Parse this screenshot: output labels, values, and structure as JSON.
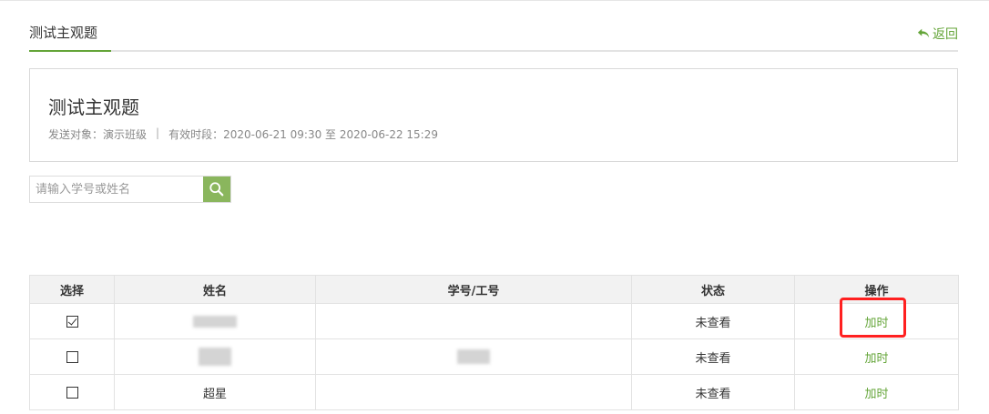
{
  "tabs": [
    {
      "label": "测试主观题",
      "active": true
    }
  ],
  "back_label": "返回",
  "info": {
    "title": "测试主观题",
    "target_label": "发送对象：",
    "target_value": "演示班级",
    "separator": "|",
    "period_label": "有效时段：",
    "period_value": "2020-06-21 09:30 至 2020-06-22 15:29"
  },
  "search": {
    "placeholder": "请输入学号或姓名",
    "value": ""
  },
  "table": {
    "headers": [
      "选择",
      "姓名",
      "学号/工号",
      "状态",
      "操作"
    ],
    "rows": [
      {
        "checked": true,
        "name": "",
        "id": "",
        "status": "未查看",
        "action": "加时"
      },
      {
        "checked": false,
        "name": "",
        "id": "",
        "status": "未查看",
        "action": "加时"
      },
      {
        "checked": false,
        "name": "超星",
        "id": "",
        "status": "未查看",
        "action": "加时"
      }
    ]
  },
  "colors": {
    "accent": "#64a539",
    "search_button": "#8ab65d",
    "highlight": "#ff2020"
  }
}
